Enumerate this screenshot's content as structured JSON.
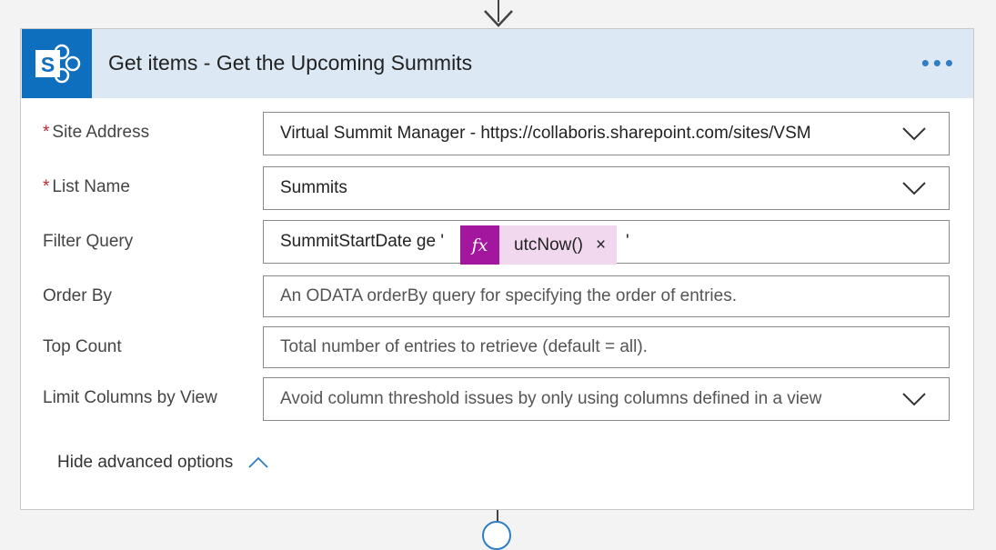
{
  "card": {
    "title": "Get items - Get the Upcoming Summits",
    "logo_letter": "S",
    "more_label": "•••"
  },
  "fields": {
    "site_address": {
      "label": "Site Address",
      "required_marker": "*",
      "value": "Virtual Summit Manager - https://collaboris.sharepoint.com/sites/VSM"
    },
    "list_name": {
      "label": "List Name",
      "required_marker": "*",
      "value": "Summits"
    },
    "filter_query": {
      "label": "Filter Query",
      "prefix": "SummitStartDate ge '",
      "token_icon": "fx",
      "token_name": "utcNow()",
      "token_close": "×",
      "suffix": "'"
    },
    "order_by": {
      "label": "Order By",
      "placeholder": "An ODATA orderBy query for specifying the order of entries."
    },
    "top_count": {
      "label": "Top Count",
      "placeholder": "Total number of entries to retrieve (default = all)."
    },
    "limit_columns": {
      "label": "Limit Columns by View",
      "placeholder": "Avoid column threshold issues by only using columns defined in a view"
    }
  },
  "advanced_toggle": "Hide advanced options",
  "colors": {
    "header_bg": "#dce8f4",
    "logo_bg": "#0f6fbf",
    "accent": "#2f7dc2",
    "expression_token": "#a2179e",
    "required": "#c4262e"
  },
  "icons": [
    "down-arrow-icon",
    "sharepoint-logo-icon",
    "more-options-icon",
    "chevron-down-icon",
    "expression-fx-icon",
    "close-icon",
    "chevron-up-icon",
    "add-step-icon"
  ]
}
